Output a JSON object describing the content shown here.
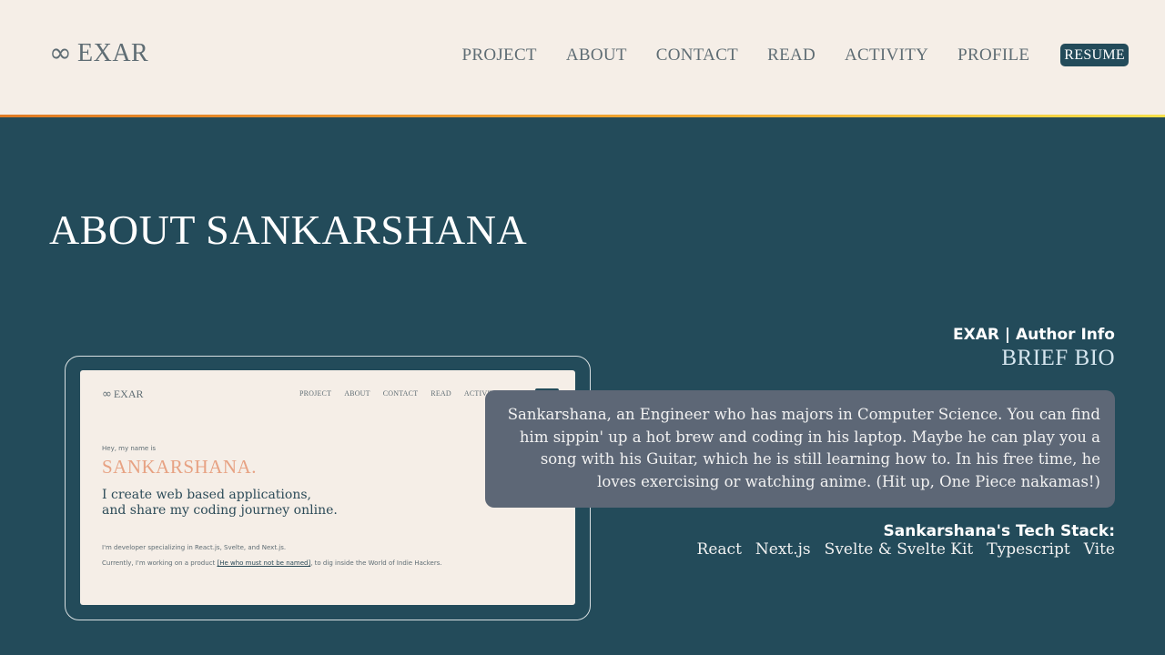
{
  "header": {
    "logo_symbol": "∞",
    "logo_text": "EXAR",
    "nav": [
      "PROJECT",
      "ABOUT",
      "CONTACT",
      "READ",
      "ACTIVITY",
      "PROFILE"
    ],
    "resume_label": "RESUME"
  },
  "main": {
    "title": "ABOUT SANKARSHANA"
  },
  "preview": {
    "logo_symbol": "∞",
    "logo_text": "EXAR",
    "nav": [
      "PROJECT",
      "ABOUT",
      "CONTACT",
      "READ",
      "ACTIVITY"
    ],
    "greeting": "Hey, my name is",
    "name": "SANKARSHANA.",
    "tagline_line1": "I create web based applications,",
    "tagline_line2": "and share my coding journey online.",
    "desc1": "I'm developer specializing in React.js, Svelte, and Next.js.",
    "desc2_before": "Currently, I'm working on a product ",
    "desc2_link": "[He who must not be named]",
    "desc2_after": ", to dig inside the World of Indie Hackers."
  },
  "bio": {
    "author_info": "EXAR | Author Info",
    "heading": "BRIEF BIO",
    "text": "Sankarshana, an Engineer who has majors in Computer Science. You can find him sippin' up a hot brew and coding in his laptop. Maybe he can play you a song with his Guitar, which he is still learning how to. In his free time, he loves exercising or watching anime. (Hit up, One Piece nakamas!)"
  },
  "tech_stack": {
    "title": "Sankarshana's Tech Stack:",
    "items": [
      "React",
      "Next.js",
      "Svelte & Svelte Kit",
      "Typescript",
      "Vite"
    ]
  },
  "colors": {
    "header_bg": "#f5eee7",
    "page_bg": "#234b5a",
    "accent_stripe": "#f0a830",
    "bio_box_bg": "#5d6776",
    "name_accent": "#e7a283"
  }
}
